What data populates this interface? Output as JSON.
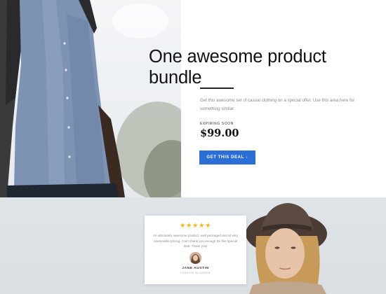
{
  "hero": {
    "title": "One awesome product bundle",
    "description": "Get this awesome set of casual clothing on a special offer. Use this area here for something similar.",
    "expiring_label": "EXPIRING SOON",
    "price": "$99.00",
    "cta_label": "GET THIS DEAL ↓",
    "accent_color": "#2b6fd6"
  },
  "testimonial": {
    "rating": 5,
    "stars": "★★★★★",
    "star_color": "#f1b622",
    "text": "An absolutely awesome product, well packaged and at very reasonable pricing. Can't thank you enough for this special deal. Thank you!",
    "name": "JANE AUSTIN",
    "role": "FASHION BLOGGER"
  }
}
